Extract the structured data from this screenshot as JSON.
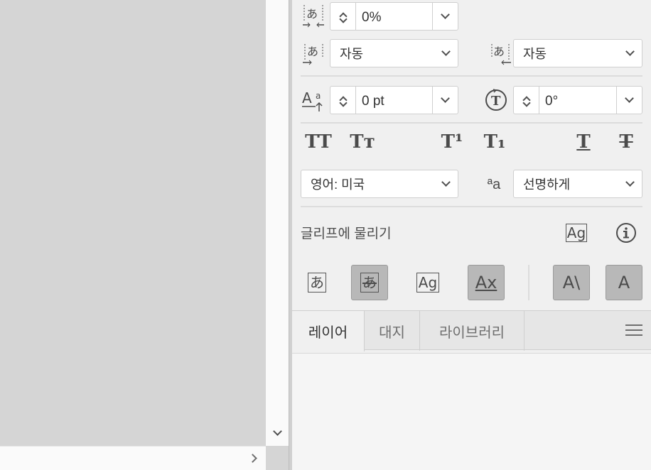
{
  "character": {
    "tsume": {
      "value": "0%"
    },
    "aki_left": {
      "value": "자동"
    },
    "aki_right": {
      "value": "자동"
    },
    "baseline_shift": {
      "value": "0 pt"
    },
    "rotation": {
      "value": "0°"
    },
    "caps": {
      "all_caps": "TT",
      "small_caps": "Tт",
      "superscript": "T¹",
      "subscript": "T₁",
      "underline": "T",
      "strikethrough": "T"
    },
    "language": {
      "value": "영어: 미국"
    },
    "anti_alias": {
      "icon_text": "ªa",
      "value": "선명하게"
    },
    "snap_label": "글리프에 물리기",
    "snap_icon_text": "Ag",
    "snap_buttons": {
      "em_box": "あ",
      "em_box_center": "あ",
      "glyph_bounds": "Ag",
      "x_height": "Ax",
      "angular_guide": "A\\",
      "anchor_point": "A"
    }
  },
  "tabs": [
    {
      "label": "레이어"
    },
    {
      "label": "대지"
    },
    {
      "label": "라이브러리"
    }
  ]
}
